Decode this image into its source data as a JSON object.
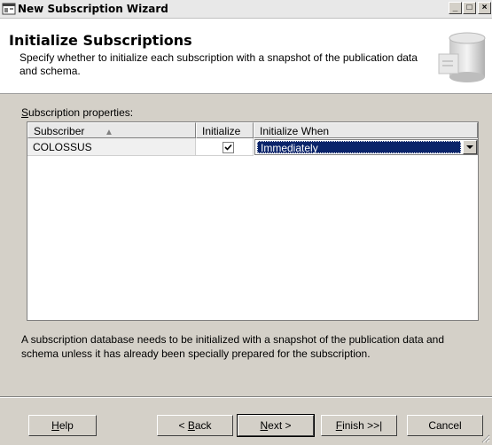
{
  "window": {
    "title": "New Subscription Wizard",
    "minimize_glyph": "_",
    "maximize_glyph": "□",
    "close_glyph": "×"
  },
  "header": {
    "title": "Initialize Subscriptions",
    "description": "Specify whether to initialize each subscription with a snapshot of the publication data and schema."
  },
  "properties": {
    "label_accel": "S",
    "label_rest": "ubscription properties:"
  },
  "grid": {
    "columns": [
      "Subscriber",
      "Initialize",
      "Initialize When"
    ],
    "sort_glyph": "▲",
    "rows": [
      {
        "subscriber": "COLOSSUS",
        "initialize": true,
        "initialize_when": "Immediately"
      }
    ]
  },
  "info_text": "A subscription database needs to be initialized with a snapshot of the publication data and schema unless it has already been specially prepared for the subscription.",
  "buttons": {
    "help": {
      "accel": "H",
      "rest": "elp"
    },
    "back": {
      "pre": "< ",
      "accel": "B",
      "rest": "ack"
    },
    "next": {
      "accel": "N",
      "rest": "ext >"
    },
    "finish": {
      "accel": "F",
      "rest": "inish >>|"
    },
    "cancel": "Cancel"
  },
  "icons": {
    "app": "wizard-app-icon",
    "header_graphic": "database-cylinder-icon",
    "checkbox": "checkmark-icon",
    "dropdown": "chevron-down-icon"
  }
}
